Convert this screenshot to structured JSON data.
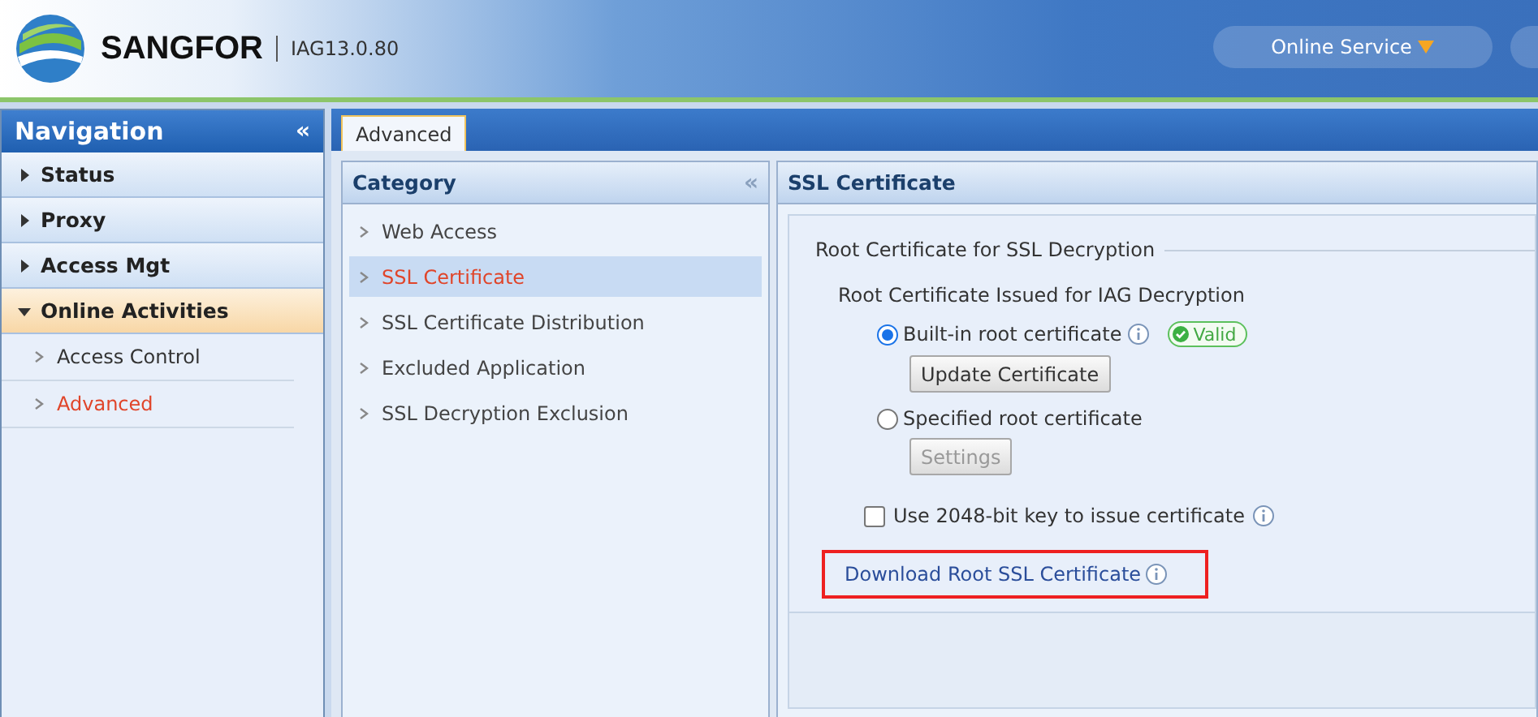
{
  "header": {
    "brand": "SANGFOR",
    "version": "IAG13.0.80",
    "menu_button": "Online Service"
  },
  "navigation": {
    "title": "Navigation",
    "collapse": "«",
    "groups": [
      {
        "label": "Status",
        "expanded": false
      },
      {
        "label": "Proxy",
        "expanded": false
      },
      {
        "label": "Access Mgt",
        "expanded": false
      },
      {
        "label": "Online Activities",
        "expanded": true,
        "children": [
          {
            "label": "Access Control",
            "selected": false
          },
          {
            "label": "Advanced",
            "selected": true
          }
        ]
      }
    ]
  },
  "tabs": [
    {
      "label": "Advanced",
      "selected": true
    }
  ],
  "category": {
    "title": "Category",
    "collapse": "«",
    "items": [
      {
        "label": "Web Access",
        "selected": false
      },
      {
        "label": "SSL Certificate",
        "selected": true
      },
      {
        "label": "SSL Certificate Distribution",
        "selected": false
      },
      {
        "label": "Excluded Application",
        "selected": false
      },
      {
        "label": "SSL Decryption Exclusion",
        "selected": false
      }
    ]
  },
  "ssl_certificate": {
    "title": "SSL Certificate",
    "legend": "Root Certificate for SSL Decryption",
    "subtitle": "Root Certificate Issued for IAG Decryption",
    "options": [
      {
        "label": "Built-in root certificate",
        "selected": true,
        "info": true,
        "badge": "Valid",
        "button": {
          "label": "Update Certificate",
          "disabled": false
        }
      },
      {
        "label": "Specified root certificate",
        "selected": false,
        "info": false,
        "button": {
          "label": "Settings",
          "disabled": true
        }
      }
    ],
    "checkbox": {
      "label": "Use 2048-bit key to issue certificate",
      "checked": false
    },
    "download_link": {
      "label": "Download Root SSL Certificate",
      "highlighted": true
    }
  }
}
